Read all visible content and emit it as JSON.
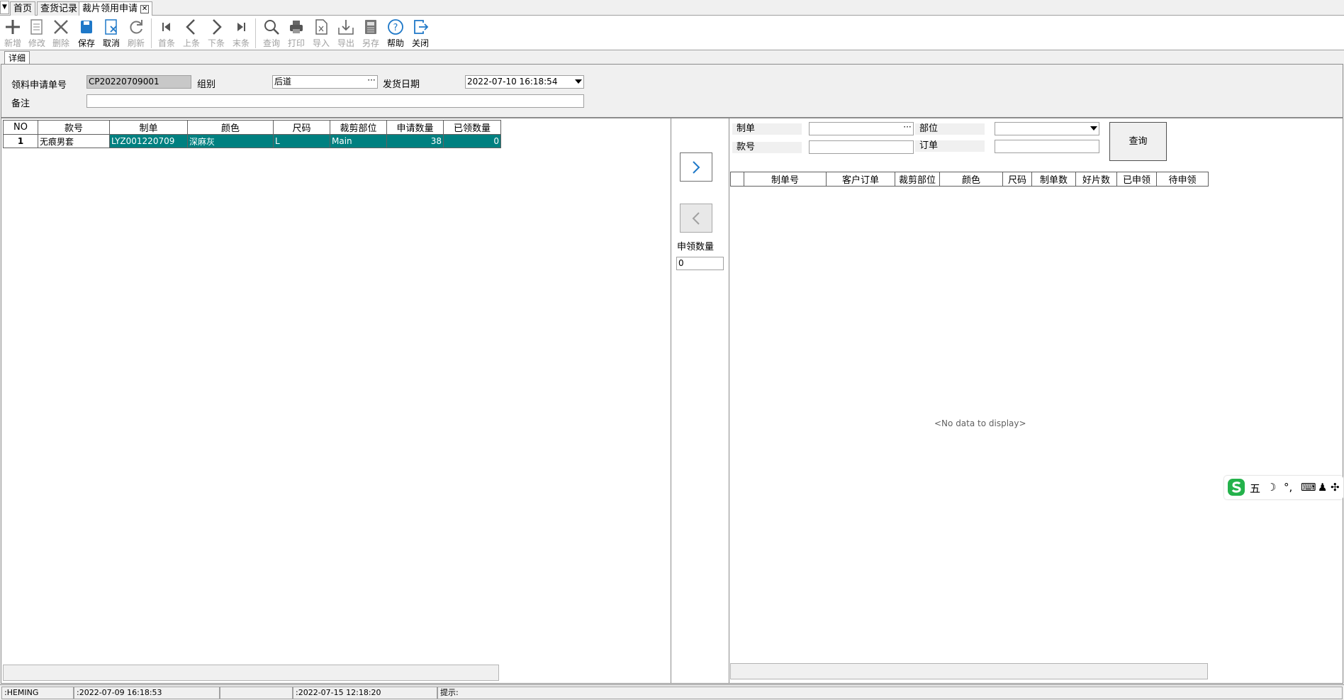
{
  "tabs": [
    {
      "label": "首页"
    },
    {
      "label": "查货记录"
    },
    {
      "label": "裁片领用申请"
    }
  ],
  "toolbar": [
    {
      "label": "新增",
      "icon": "plus-icon",
      "enabled": false
    },
    {
      "label": "修改",
      "icon": "edit-doc-icon",
      "enabled": false
    },
    {
      "label": "删除",
      "icon": "delete-x-icon",
      "enabled": false
    },
    {
      "label": "保存",
      "icon": "save-icon",
      "enabled": true
    },
    {
      "label": "取消",
      "icon": "cancel-doc-icon",
      "enabled": true
    },
    {
      "label": "刷新",
      "icon": "refresh-icon",
      "enabled": false
    },
    {
      "label": "首条",
      "icon": "first-record-icon",
      "enabled": false
    },
    {
      "label": "上条",
      "icon": "prev-record-icon",
      "enabled": false
    },
    {
      "label": "下条",
      "icon": "next-record-icon",
      "enabled": false
    },
    {
      "label": "末条",
      "icon": "last-record-icon",
      "enabled": false
    },
    {
      "label": "查询",
      "icon": "search-icon",
      "enabled": false
    },
    {
      "label": "打印",
      "icon": "printer-icon",
      "enabled": false
    },
    {
      "label": "导入",
      "icon": "import-excel-icon",
      "enabled": false
    },
    {
      "label": "导出",
      "icon": "export-icon",
      "enabled": false
    },
    {
      "label": "另存",
      "icon": "save-as-icon",
      "enabled": false
    },
    {
      "label": "帮助",
      "icon": "help-icon",
      "enabled": true
    },
    {
      "label": "关闭",
      "icon": "exit-icon",
      "enabled": true
    }
  ],
  "detail_tab": "详细",
  "form": {
    "req_no_label": "领料申请单号",
    "req_no_value": "CP20220709001",
    "group_label": "组别",
    "group_value": "后道",
    "ship_date_label": "发货日期",
    "ship_date_value": "2022-07-10 16:18:54",
    "remark_label": "备注",
    "remark_value": ""
  },
  "left_grid": {
    "headers": [
      "NO",
      "款号",
      "制单",
      "颜色",
      "尺码",
      "裁剪部位",
      "申请数量",
      "已领数量"
    ],
    "rows": [
      [
        "1",
        "无痕男套",
        "LYZ001220709",
        "深麻灰",
        "L",
        "Main",
        "38",
        "0"
      ]
    ]
  },
  "middle": {
    "qty_label": "申领数量",
    "qty_value": "0"
  },
  "right_filters": {
    "order_label": "制单",
    "order_value": "",
    "part_label": "部位",
    "part_value": "",
    "style_label": "款号",
    "style_value": "",
    "po_label": "订单",
    "po_value": "",
    "query_button": "查询"
  },
  "right_grid": {
    "headers": [
      "",
      "制单号",
      "客户订单",
      "裁剪部位",
      "颜色",
      "尺码",
      "制单数",
      "好片数",
      "已申领",
      "待申领"
    ],
    "empty_text": "<No data to display>"
  },
  "statusbar": [
    ":HEMING",
    ":2022-07-09 16:18:53",
    "",
    ":2022-07-15 12:18:20",
    "提示:"
  ],
  "ime": {
    "mode": "五"
  }
}
